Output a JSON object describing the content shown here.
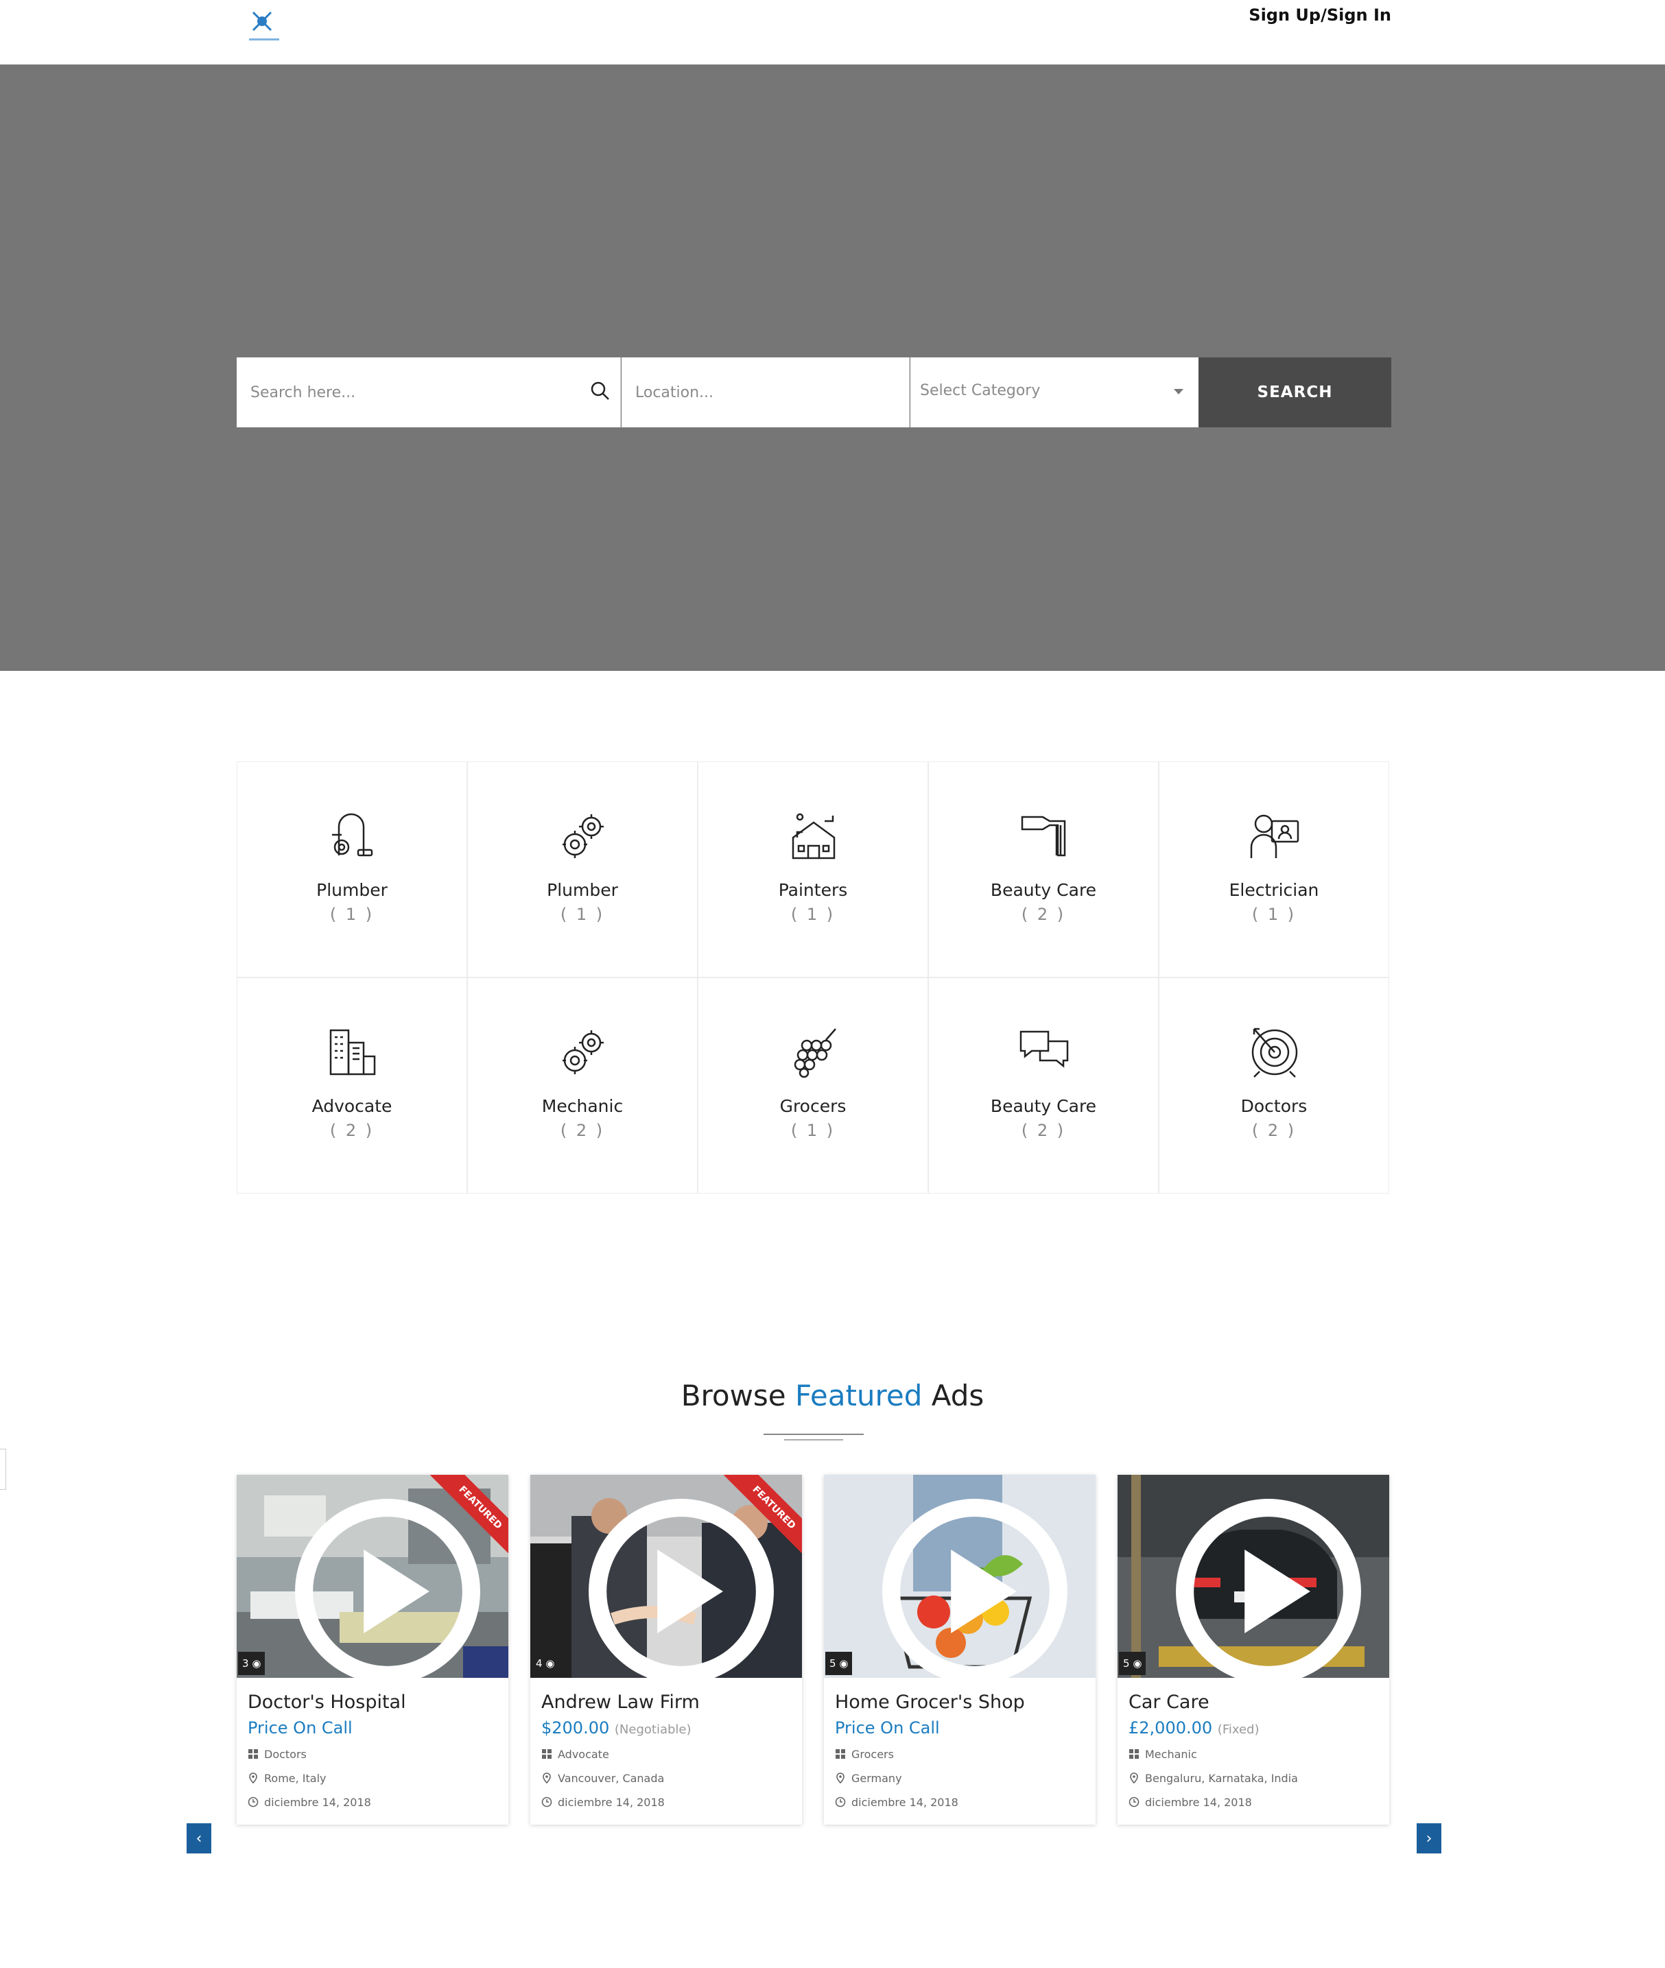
{
  "header": {
    "auth_link": "Sign Up/Sign In"
  },
  "search": {
    "keyword_placeholder": "Search here...",
    "location_placeholder": "Location...",
    "category_placeholder": "Select Category",
    "button_label": "SEARCH"
  },
  "categories": [
    {
      "name": "Plumber",
      "count": "( 1 )",
      "icon": "vacuum-icon"
    },
    {
      "name": "Plumber",
      "count": "( 1 )",
      "icon": "gears-icon"
    },
    {
      "name": "Painters",
      "count": "( 1 )",
      "icon": "house-icon"
    },
    {
      "name": "Beauty Care",
      "count": "( 2 )",
      "icon": "paint-roller-icon"
    },
    {
      "name": "Electrician",
      "count": "( 1 )",
      "icon": "user-screen-icon"
    },
    {
      "name": "Advocate",
      "count": "( 2 )",
      "icon": "buildings-icon"
    },
    {
      "name": "Mechanic",
      "count": "( 2 )",
      "icon": "gears-icon"
    },
    {
      "name": "Grocers",
      "count": "( 1 )",
      "icon": "grapes-icon"
    },
    {
      "name": "Beauty Care",
      "count": "( 2 )",
      "icon": "chat-bubbles-icon"
    },
    {
      "name": "Doctors",
      "count": "( 2 )",
      "icon": "target-icon"
    }
  ],
  "featured": {
    "title_pre": "Browse ",
    "title_hl": "Featured",
    "title_post": " Ads",
    "ribbon": "FEATURED",
    "ads": [
      {
        "title": "Doctor's Hospital",
        "price": "Price On Call",
        "price_note": "",
        "category": "Doctors",
        "location": "Rome, Italy",
        "date": "diciembre 14, 2018",
        "photos": "3"
      },
      {
        "title": "Andrew Law Firm",
        "price": "$200.00",
        "price_note": "(Negotiable)",
        "category": "Advocate",
        "location": "Vancouver, Canada",
        "date": "diciembre 14, 2018",
        "photos": "4"
      },
      {
        "title": "Home Grocer's Shop",
        "price": "Price On Call",
        "price_note": "",
        "category": "Grocers",
        "location": "Germany",
        "date": "diciembre 14, 2018",
        "photos": "5"
      },
      {
        "title": "Car Care",
        "price": "£2,000.00",
        "price_note": "(Fixed)",
        "category": "Mechanic",
        "location": "Bengaluru, Karnataka, India",
        "date": "diciembre 14, 2018",
        "photos": "5"
      }
    ]
  },
  "colors": {
    "accent": "#1a7cc0",
    "hero_bg": "#767676",
    "search_btn": "#4a4a4a",
    "ribbon": "#d62b2b",
    "nav_btn": "#1a5f9c"
  },
  "nav": {
    "prev": "‹",
    "next": "›"
  }
}
